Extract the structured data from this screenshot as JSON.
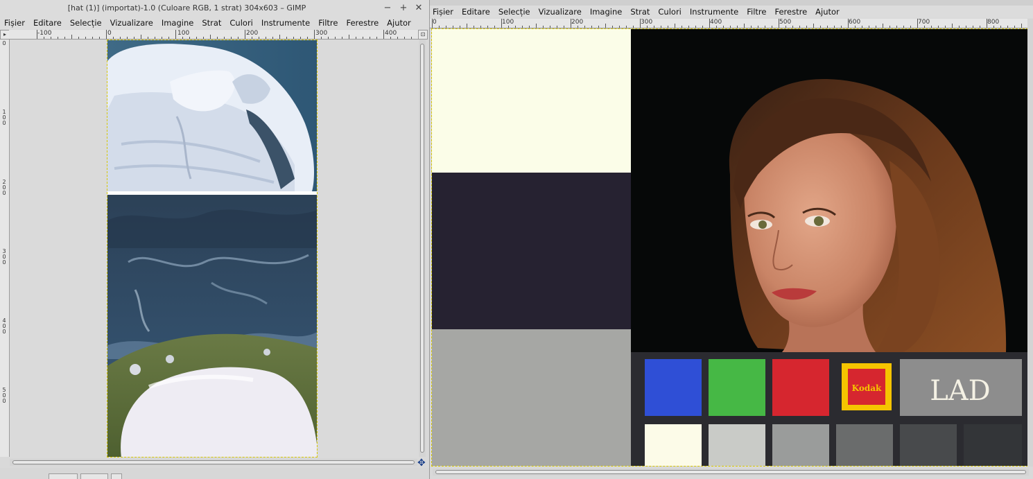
{
  "left_window": {
    "title": "[hat (1)] (importat)-1.0 (Culoare RGB, 1 strat) 304x603 – GIMP",
    "controls": {
      "minimize": "−",
      "maximize": "+",
      "close": "✕"
    },
    "menu": [
      "Fișier",
      "Editare",
      "Selecție",
      "Vizualizare",
      "Imagine",
      "Strat",
      "Culori",
      "Instrumente",
      "Filtre",
      "Ferestre",
      "Ajutor"
    ],
    "ruler_h": [
      "-100",
      "0",
      "100",
      "200",
      "300",
      "400"
    ],
    "ruler_v": [
      [
        "0"
      ],
      [
        "1",
        "0",
        "0"
      ],
      [
        "2",
        "0",
        "0"
      ],
      [
        "3",
        "0",
        "0"
      ],
      [
        "4",
        "0",
        "0"
      ],
      [
        "5",
        "0",
        "0"
      ]
    ]
  },
  "right_window": {
    "menu": [
      "Fișier",
      "Editare",
      "Selecție",
      "Vizualizare",
      "Imagine",
      "Strat",
      "Culori",
      "Instrumente",
      "Filtre",
      "Ferestre",
      "Ajutor"
    ],
    "ruler_h": [
      "0",
      "100",
      "200",
      "300",
      "400",
      "500",
      "600",
      "700",
      "800"
    ],
    "chart_text": {
      "kodak": "Kodak",
      "lad": "LAD"
    }
  },
  "icons": {
    "nav": "navigate-icon",
    "menu_arrow": "menu-arrow-icon",
    "zoom": "zoom-fit-icon"
  },
  "colors": {
    "selection_border": "#d8c800",
    "patch_blue": "#2f4fd6",
    "patch_green": "#46b845",
    "patch_red": "#d6262f",
    "kodak_yellow": "#f5c400"
  }
}
